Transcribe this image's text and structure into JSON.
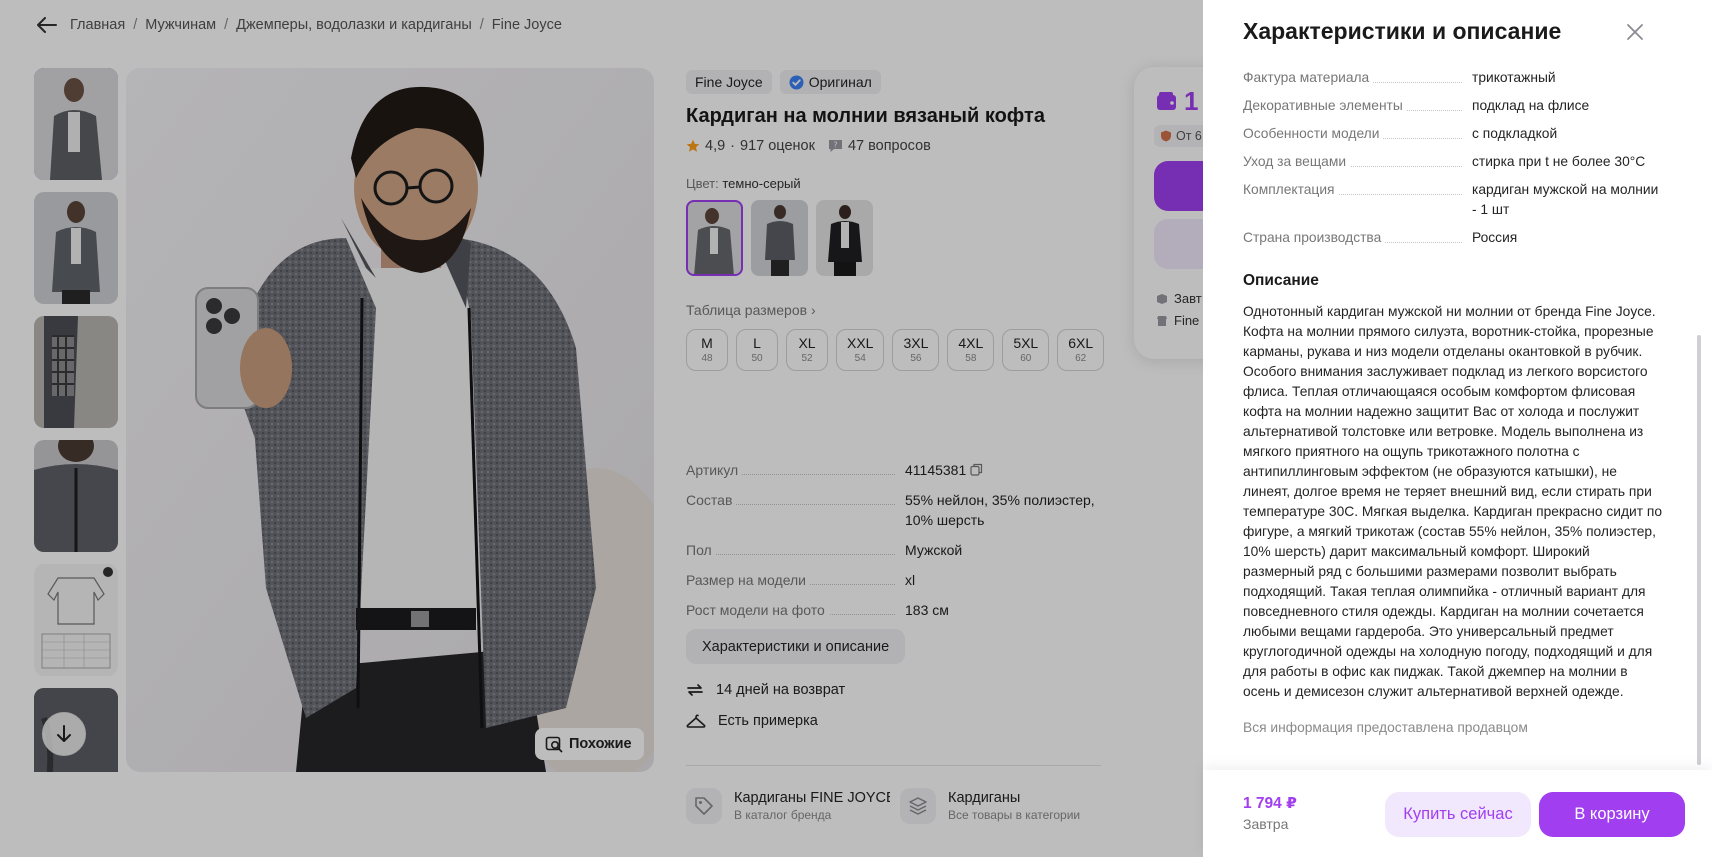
{
  "breadcrumbs": [
    "Главная",
    "Мужчинам",
    "Джемперы, водолазки и кардиганы",
    "Fine Joyce"
  ],
  "gallery": {
    "thumbnails": [
      "photo-1",
      "photo-2",
      "photo-3",
      "photo-4",
      "size-chart",
      "photo-6"
    ],
    "similar_label": "Похожие"
  },
  "product": {
    "brand": "Fine Joyce",
    "original_badge": "Оригинал",
    "title": "Кардиган на молнии вязаный кофта",
    "rating": "4,9",
    "reviews": "917 оценок",
    "questions": "47 вопросов",
    "color_label": "Цвет:",
    "color_value": "темно-серый",
    "size_table_label": "Таблица размеров",
    "sizes": [
      {
        "size": "M",
        "ru": "48"
      },
      {
        "size": "L",
        "ru": "50"
      },
      {
        "size": "XL",
        "ru": "52"
      },
      {
        "size": "XXL",
        "ru": "54"
      },
      {
        "size": "3XL",
        "ru": "56"
      },
      {
        "size": "4XL",
        "ru": "58"
      },
      {
        "size": "5XL",
        "ru": "60"
      },
      {
        "size": "6XL",
        "ru": "62"
      }
    ],
    "params": [
      {
        "k": "Артикул",
        "v": "41145381"
      },
      {
        "k": "Состав",
        "v": "55% нейлон, 35% полиэстер, 10% шерсть"
      },
      {
        "k": "Пол",
        "v": "Мужской"
      },
      {
        "k": "Размер на модели",
        "v": "xl"
      },
      {
        "k": "Рост модели на фото",
        "v": "183 см"
      }
    ],
    "characteristics_button": "Характеристики и описание",
    "perks": [
      "14 дней на возврат",
      "Есть примерка"
    ],
    "categories": [
      {
        "title": "Кардиганы FINE JOYCE",
        "subtitle": "В каталог бренда"
      },
      {
        "title": "Кардиганы",
        "subtitle": "Все товары в категории"
      }
    ]
  },
  "buy_card": {
    "price_fragment": "1",
    "seller_fragment": "От 6",
    "delivery_fragment": "Завт",
    "brand_fragment": "Fine"
  },
  "panel": {
    "title": "Характеристики и описание",
    "specs": [
      {
        "k": "Фактура материала",
        "v": "трикотажный"
      },
      {
        "k": "Декоративные элементы",
        "v": "подклад на флисе"
      },
      {
        "k": "Особенности модели",
        "v": "с подкладкой"
      },
      {
        "k": "Уход за вещами",
        "v": "стирка при t не более 30°C"
      },
      {
        "k": "Комплектация",
        "v": "кардиган мужской на молнии - 1 шт"
      },
      {
        "k": "Страна производства",
        "v": "Россия"
      }
    ],
    "description_heading": "Описание",
    "description": "Однотонный кардиган мужской ни молнии от бренда Fine Joyce. Кофта на молнии прямого силуэта, воротник-стойка, прорезные карманы, рукава и низ модели отделаны окантовкой в рубчик. Особого внимания заслуживает подклад из легкого ворсистого флиса. Теплая отличающаяся особым комфортом флисовая кофта на молнии надежно защитит Вас от холода и послужит альтернативой толстовке или ветровке. Модель выполнена из мягкого приятного на ощупь трикотажного полотна с антипиллинговым эффектом (не образуются катышки), не линеят, долгое время не теряет внешний вид, если стирать при температуре 30С. Мягкая выделка. Кардиган прекрасно сидит по фигуре, а мягкий трикотаж (состав 55% нейлон, 35% полиэстер, 10% шерсть) дарит максимальный комфорт. Широкий размерный ряд с большими размерами позволит выбрать подходящий. Такая теплая олимпийка - отличный вариант для повседневного стиля одежды. Кардиган на молнии сочетается любыми вещами гардероба. Это универсальный предмет круглогодичной одежды на холодную погоду, подходящий и для для работы в офис как пиджак. Такой джемпер на молнии в осень и демисезон служит альтернативой верхней одежде.",
    "disclaimer": "Вся информация предоставлена продавцом",
    "footer": {
      "price": "1 794 ₽",
      "delivery": "Завтра",
      "buy_now": "Купить сейчас",
      "add_to_cart": "В корзину"
    }
  },
  "colors": {
    "accent": "#a03ef0",
    "accent_light": "#f1e8fd",
    "overlay": "rgba(0,0,0,0.26)"
  }
}
